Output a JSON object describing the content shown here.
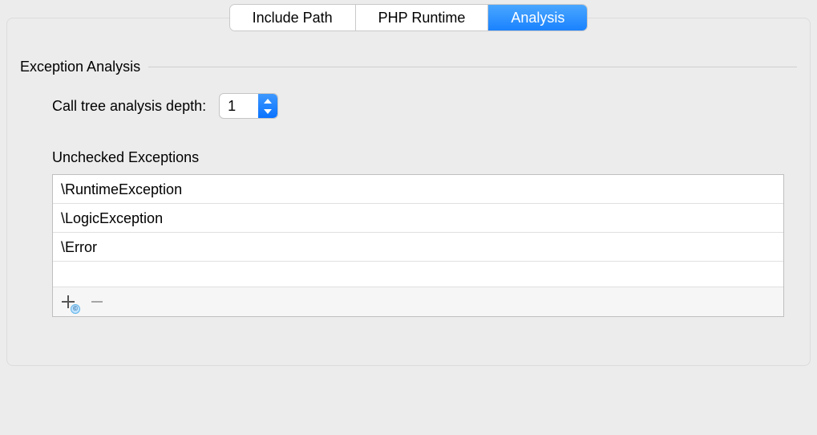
{
  "tabs": {
    "include_path": "Include Path",
    "php_runtime": "PHP Runtime",
    "analysis": "Analysis"
  },
  "section_title": "Exception Analysis",
  "depth_label": "Call tree analysis depth:",
  "depth_value": "1",
  "unchecked_label": "Unchecked Exceptions",
  "exceptions": {
    "0": "\\RuntimeException",
    "1": "\\LogicException",
    "2": "\\Error"
  },
  "add_badge": "©"
}
